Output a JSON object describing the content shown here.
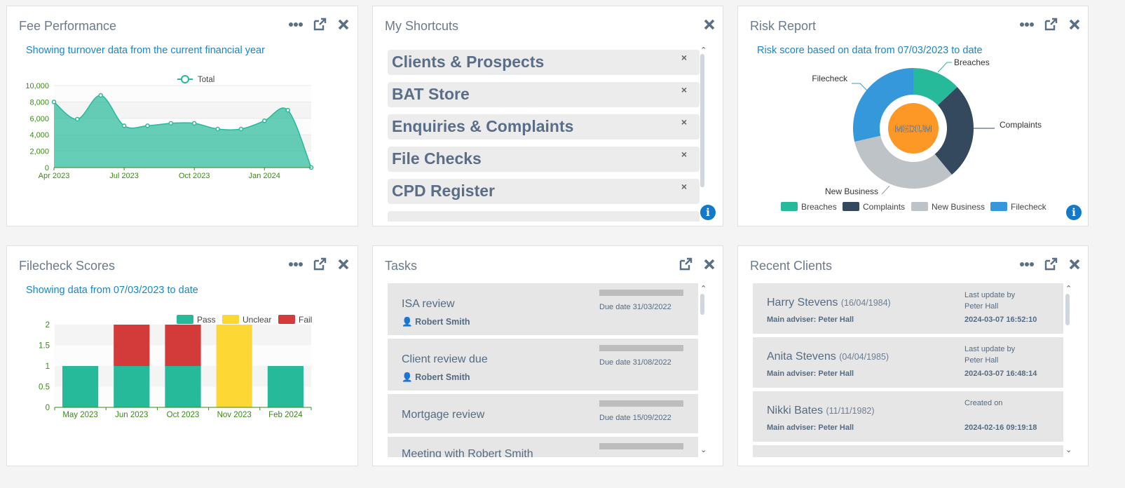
{
  "fee": {
    "title": "Fee Performance",
    "subtitle": "Showing turnover data from the current financial year",
    "legend": "Total"
  },
  "shortcuts": {
    "title": "My Shortcuts",
    "items": [
      {
        "label": "Clients & Prospects"
      },
      {
        "label": "BAT Store"
      },
      {
        "label": "Enquiries & Complaints"
      },
      {
        "label": "File Checks"
      },
      {
        "label": "CPD Register"
      }
    ],
    "remove_glyph": "×"
  },
  "risk": {
    "title": "Risk Report",
    "subtitle": "Risk score based on data from 07/03/2023 to date",
    "center_label": "MEDIUM",
    "legend": [
      "Breaches",
      "Complaints",
      "New Business",
      "Filecheck"
    ]
  },
  "filecheck": {
    "title": "Filecheck Scores",
    "subtitle": "Showing data from 07/03/2023 to date"
  },
  "tasks": {
    "title": "Tasks",
    "items": [
      {
        "title": "ISA review",
        "person": "Robert Smith",
        "due": "Due date 31/03/2022"
      },
      {
        "title": "Client review due",
        "person": "Robert Smith",
        "due": "Due date 31/08/2022"
      },
      {
        "title": "Mortgage review",
        "person": "",
        "due": "Due date 15/09/2022"
      },
      {
        "title": "Meeting with Robert Smith",
        "person": "",
        "due": ""
      }
    ]
  },
  "recent": {
    "title": "Recent Clients",
    "items": [
      {
        "name": "Harry Stevens",
        "dob": "(16/04/1984)",
        "adviser": "Main adviser: Peter Hall",
        "update_label": "Last update by",
        "update_by": "Peter Hall",
        "datetime": "2024-03-07 16:52:10"
      },
      {
        "name": "Anita Stevens",
        "dob": "(04/04/1985)",
        "adviser": "Main adviser: Peter Hall",
        "update_label": "Last update by",
        "update_by": "Peter Hall",
        "datetime": "2024-03-07 16:48:14"
      },
      {
        "name": "Nikki Bates",
        "dob": "(11/11/1982)",
        "adviser": "Main adviser: Peter Hall",
        "update_label": "Created on",
        "update_by": "",
        "datetime": "2024-02-16 09:19:18"
      }
    ]
  },
  "colors": {
    "accent_blue": "#1a86c8",
    "green": "#26b99a",
    "navy": "#34495e",
    "grey": "#bdc3c7",
    "blue": "#3498db",
    "red": "#d33a3a",
    "yellow": "#fdd835",
    "orange": "#fd9826"
  },
  "chart_data": [
    {
      "type": "area",
      "title": "",
      "x": [
        "Apr 2023",
        "May 2023",
        "Jun 2023",
        "Jul 2023",
        "Aug 2023",
        "Sep 2023",
        "Oct 2023",
        "Nov 2023",
        "Dec 2023",
        "Jan 2024",
        "Feb 2024",
        "Mar 2024"
      ],
      "xticks": [
        "Apr 2023",
        "Jul 2023",
        "Oct 2023",
        "Jan 2024"
      ],
      "series": [
        {
          "name": "Total",
          "values": [
            8000,
            5900,
            8800,
            5100,
            5100,
            5400,
            5400,
            4700,
            4700,
            5700,
            7000,
            0
          ]
        }
      ],
      "yticks": [
        0,
        2000,
        4000,
        6000,
        8000,
        10000
      ],
      "ytick_labels": [
        "0",
        "2,000",
        "4,000",
        "6,000",
        "8,000",
        "10,000"
      ],
      "ylim": [
        0,
        10000
      ],
      "legend": "top"
    },
    {
      "type": "pie",
      "donut": true,
      "slices": [
        {
          "name": "Breaches",
          "value": 1
        },
        {
          "name": "Complaints",
          "value": 2
        },
        {
          "name": "New Business",
          "value": 2.5
        },
        {
          "name": "Filecheck",
          "value": 2.2
        }
      ],
      "center_label": "MEDIUM",
      "legend": "bottom"
    },
    {
      "type": "bar",
      "stacked": true,
      "categories": [
        "May 2023",
        "Jun 2023",
        "Oct 2023",
        "Nov 2023",
        "Feb 2024"
      ],
      "series": [
        {
          "name": "Pass",
          "values": [
            1,
            1,
            1,
            0,
            1
          ]
        },
        {
          "name": "Unclear",
          "values": [
            0,
            0,
            0,
            2,
            0
          ]
        },
        {
          "name": "Fail",
          "values": [
            0,
            1,
            1,
            0,
            0
          ]
        }
      ],
      "yticks": [
        0,
        0.5,
        1,
        1.5,
        2
      ],
      "ylim": [
        0,
        2
      ],
      "legend": "top-right"
    }
  ]
}
